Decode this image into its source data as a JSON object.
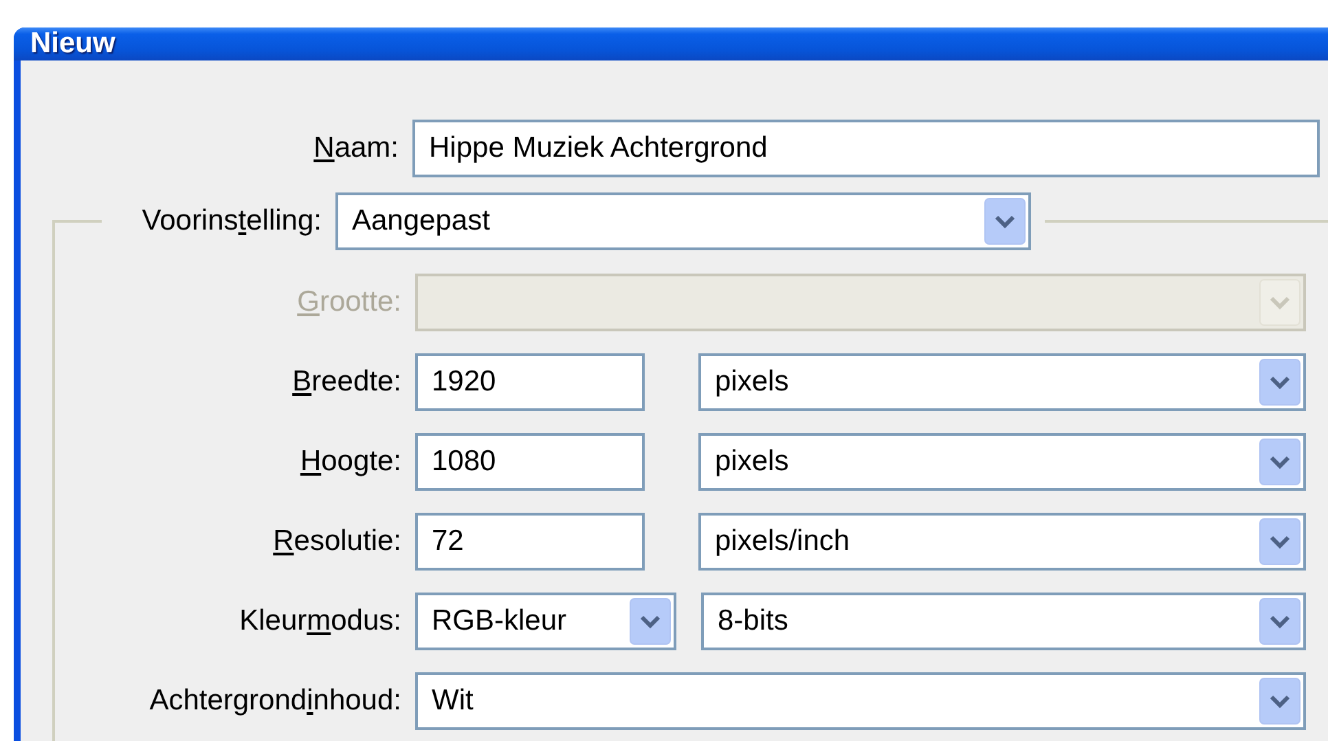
{
  "window": {
    "title": "Nieuw"
  },
  "name_field": {
    "label_parts": [
      {
        "text": "N",
        "underlined": true
      },
      {
        "text": "aam:",
        "underlined": false
      }
    ],
    "value": "Hippe Muziek Achtergrond"
  },
  "preset": {
    "label_parts": [
      {
        "text": "Voorins",
        "underlined": false
      },
      {
        "text": "t",
        "underlined": true
      },
      {
        "text": "elling:",
        "underlined": false
      }
    ],
    "value": "Aangepast"
  },
  "settings": [
    {
      "label_parts": [
        {
          "text": "G",
          "underlined": true
        },
        {
          "text": "rootte:",
          "underlined": false
        }
      ],
      "disabled": true,
      "controls": [
        {
          "kind": "select"
        }
      ]
    },
    {
      "label_parts": [
        {
          "text": "B",
          "underlined": true
        },
        {
          "text": "reedte:",
          "underlined": false
        }
      ],
      "disabled": false,
      "controls": [
        {
          "kind": "input",
          "value": "1920"
        },
        {
          "kind": "select",
          "value": "pixels"
        }
      ]
    },
    {
      "label_parts": [
        {
          "text": "H",
          "underlined": true
        },
        {
          "text": "oogte:",
          "underlined": false
        }
      ],
      "disabled": false,
      "controls": [
        {
          "kind": "input",
          "value": "1080"
        },
        {
          "kind": "select",
          "value": "pixels"
        }
      ]
    },
    {
      "label_parts": [
        {
          "text": "R",
          "underlined": true
        },
        {
          "text": "esolutie:",
          "underlined": false
        }
      ],
      "disabled": false,
      "controls": [
        {
          "kind": "input",
          "value": "72"
        },
        {
          "kind": "select",
          "value": "pixels/inch"
        }
      ]
    },
    {
      "label_parts": [
        {
          "text": "Kleur",
          "underlined": false
        },
        {
          "text": "m",
          "underlined": true
        },
        {
          "text": "odus:",
          "underlined": false
        }
      ],
      "disabled": false,
      "controls": [
        {
          "kind": "select",
          "value": "RGB-kleur"
        },
        {
          "kind": "select",
          "value": "8-bits"
        }
      ]
    },
    {
      "label_parts": [
        {
          "text": "Achtergrond",
          "underlined": false
        },
        {
          "text": "i",
          "underlined": true
        },
        {
          "text": "nhoud:",
          "underlined": false
        }
      ],
      "disabled": false,
      "controls": [
        {
          "kind": "select",
          "value": "Wit"
        }
      ]
    }
  ]
}
